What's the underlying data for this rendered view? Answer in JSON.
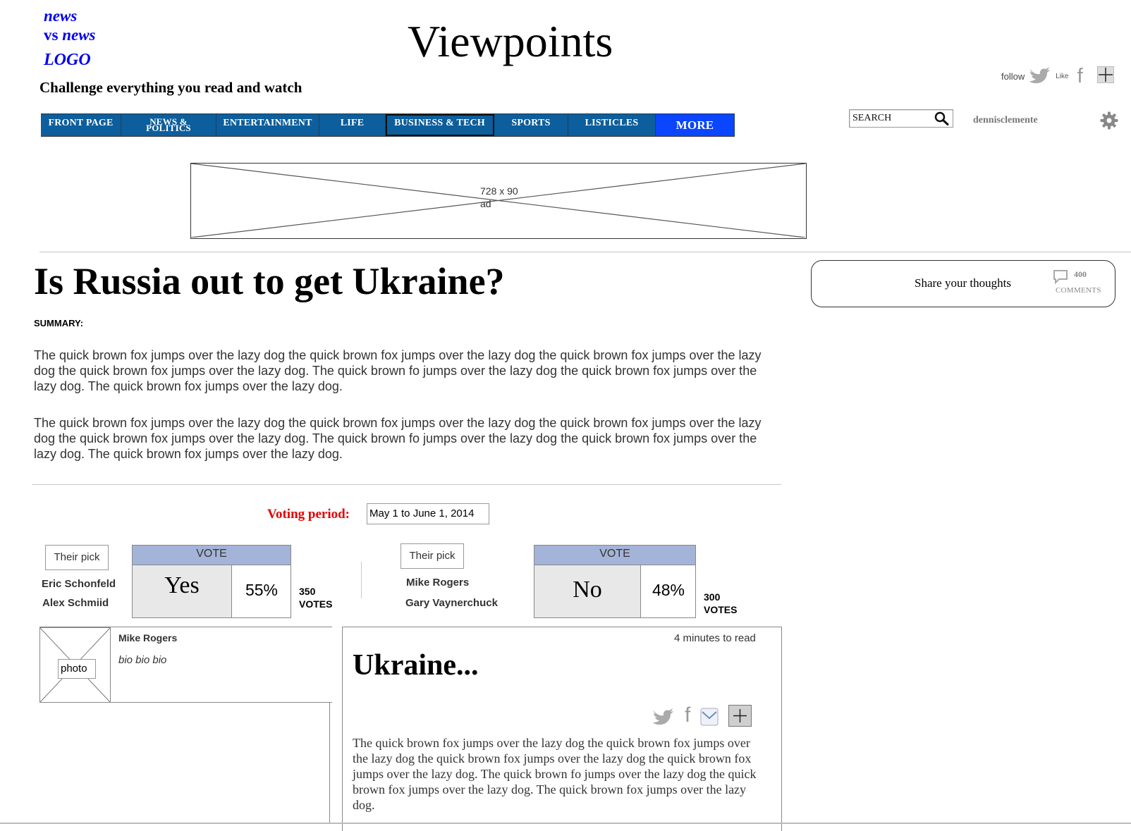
{
  "logo": {
    "line1": "news",
    "line2_plain": "vs ",
    "line2_italic": "news",
    "line3": "LOGO"
  },
  "site_title": "Viewpoints",
  "tagline": "Challenge everything you read and watch",
  "nav": {
    "items": [
      {
        "label": "FRONT PAGE"
      },
      {
        "label": "NEWS &"
      },
      {
        "label": "POLITICS"
      },
      {
        "label": "ENTERTAINMENT"
      },
      {
        "label": "LIFE"
      },
      {
        "label": "BUSINESS & TECH"
      },
      {
        "label": "SPORTS"
      },
      {
        "label": "LISTICLES"
      },
      {
        "label": "MORE"
      }
    ]
  },
  "social": {
    "follow_label": "follow",
    "like_label": "Like",
    "facebook_glyph": "f"
  },
  "search": {
    "label": "SEARCH"
  },
  "user": {
    "name": "dennisclemente"
  },
  "ad": {
    "size": "728 x 90",
    "label": "ad"
  },
  "article": {
    "headline": "Is Russia out to get Ukraine?",
    "summary_label": "SUMMARY:",
    "paragraphs": [
      "The quick brown fox jumps over the lazy dog the quick brown fox jumps over the lazy dog the quick brown fox jumps over the lazy dog the quick brown fox jumps over the lazy dog. The quick brown fo jumps over the lazy dog the quick brown fox jumps over the lazy dog. The quick brown fox jumps over the lazy dog.",
      "The quick brown fox jumps over the lazy dog the quick brown fox jumps over the lazy dog the quick brown fox jumps over the lazy dog the quick brown fox jumps over the lazy dog. The quick brown fo jumps over the lazy dog the quick brown fox jumps over the lazy dog. The quick brown fox jumps over the lazy dog."
    ]
  },
  "share": {
    "text": "Share your thoughts",
    "comment_count": "400",
    "comment_label": "COMMENTS"
  },
  "voting": {
    "period_label": "Voting period:",
    "period_value": "May 1 to June 1, 2014"
  },
  "yes_side": {
    "pick_label": "Their pick",
    "names": [
      "Eric Schonfeld",
      "Alex Schmiid"
    ],
    "vote_label": "VOTE",
    "choice": "Yes",
    "percent": "55%",
    "percent_value": 55,
    "votes_number": "350",
    "votes_word": "VOTES"
  },
  "no_side": {
    "pick_label": "Their pick",
    "names": [
      "Mike Rogers",
      "Gary Vaynerchuck"
    ],
    "vote_label": "VOTE",
    "choice": "No",
    "percent": "48%",
    "percent_value": 48,
    "votes_number": "300",
    "votes_word": "VOTES"
  },
  "author": {
    "photo_label": "photo",
    "name": "Mike Rogers",
    "bio": "bio bio bio"
  },
  "op_ed": {
    "read_time": "4 minutes to read",
    "title": "Ukraine...",
    "body": "The quick brown fox jumps over the lazy dog the quick brown fox jumps over the lazy dog the quick brown fox jumps over the lazy dog the quick brown fox jumps over the lazy dog. The quick brown fo jumps over the lazy dog the quick brown fox jumps over the lazy dog. The quick brown fox jumps over the lazy dog."
  },
  "colors": {
    "logo_blue": "#0000ee",
    "nav_blue": "#0c5e9c",
    "more_blue": "#0a45ff",
    "vote_header": "#a4b4d8",
    "voting_red": "#e60000"
  }
}
